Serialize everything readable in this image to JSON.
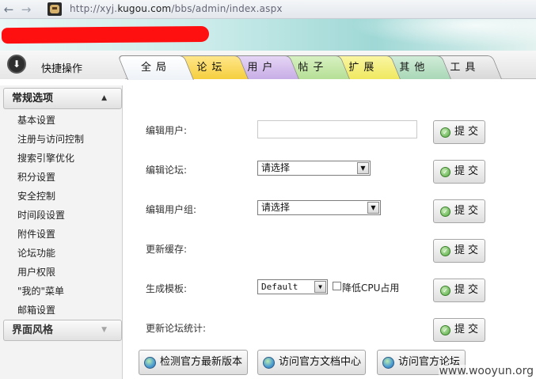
{
  "browser": {
    "back_icon": "back-arrow-icon",
    "forward_icon": "forward-arrow-icon",
    "url_prefix": "http://xyj.",
    "url_domain": "kugou.com",
    "url_path": "/bbs/admin/index.aspx"
  },
  "quick_ops": {
    "label": "快捷操作",
    "icon": "down-arrow-circle-icon"
  },
  "tabs": [
    {
      "label": "全局",
      "active": true,
      "color": "#ffffff"
    },
    {
      "label": "论坛",
      "color": "#f5cf3e"
    },
    {
      "label": "用户",
      "color": "#c7aee6"
    },
    {
      "label": "帖子",
      "color": "#b6df96"
    },
    {
      "label": "扩展",
      "color": "#efe85f"
    },
    {
      "label": "其他",
      "color": "#a9d7b6"
    },
    {
      "label": "工具",
      "color": "#d8d8d8"
    }
  ],
  "sidebar": {
    "groups": [
      {
        "title": "常规选项",
        "expanded": true,
        "items": [
          "基本设置",
          "注册与访问控制",
          "搜索引擎优化",
          "积分设置",
          "安全控制",
          "时间段设置",
          "附件设置",
          "论坛功能",
          "用户权限",
          "\"我的\"菜单",
          "邮箱设置"
        ]
      },
      {
        "title": "界面风格",
        "expanded": false
      }
    ]
  },
  "form": {
    "rows": [
      {
        "label": "编辑用户:",
        "control": "text",
        "value": "",
        "button": "提交"
      },
      {
        "label": "编辑论坛:",
        "control": "select",
        "value": "请选择",
        "button": "提交"
      },
      {
        "label": "编辑用户组:",
        "control": "select",
        "value": "请选择",
        "button": "提交"
      },
      {
        "label": "更新缓存:",
        "control": "none",
        "button": "提交"
      },
      {
        "label": "生成模板:",
        "control": "select",
        "value": "Default",
        "checkbox_label": "降低CPU占用",
        "checkbox_checked": false,
        "button": "提交"
      },
      {
        "label": "更新论坛统计:",
        "control": "none",
        "button": "提交"
      }
    ]
  },
  "bottom_buttons": [
    "检测官方最新版本",
    "访问官方文档中心",
    "访问官方论坛"
  ],
  "watermark": "www.wooyun.org"
}
